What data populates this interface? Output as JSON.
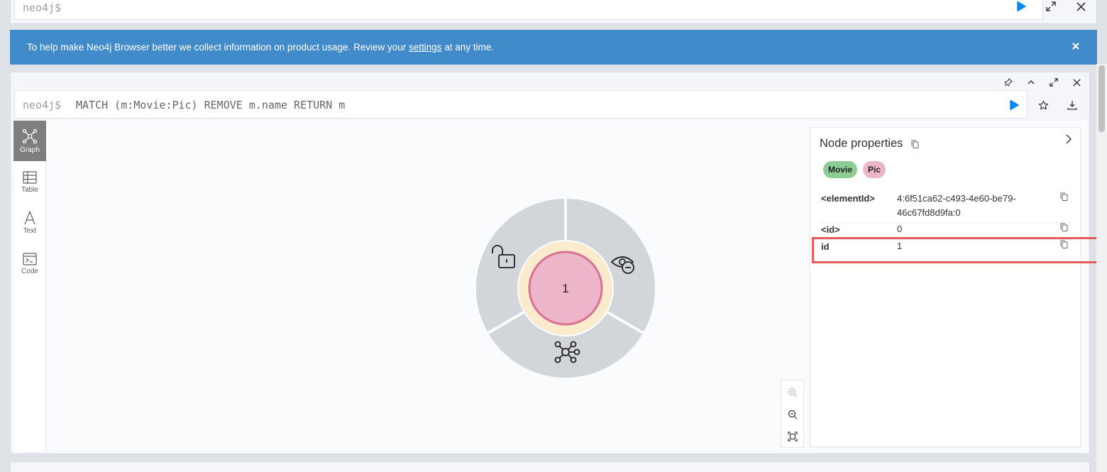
{
  "top_editor": {
    "prompt": "neo4j$"
  },
  "banner": {
    "text_before": "To help make Neo4j Browser better we collect information on product usage. Review your",
    "link": "settings",
    "text_after": "at any time."
  },
  "frame": {
    "prompt": "neo4j$",
    "query": "MATCH (m:Movie:Pic) REMOVE m.name RETURN m"
  },
  "views": [
    {
      "label": "Graph",
      "icon": "graph-icon",
      "active": true
    },
    {
      "label": "Table",
      "icon": "table-icon",
      "active": false
    },
    {
      "label": "Text",
      "icon": "text-icon",
      "active": false
    },
    {
      "label": "Code",
      "icon": "code-icon",
      "active": false
    }
  ],
  "node": {
    "caption": "1",
    "fill": "#ecb5c9",
    "stroke": "#da7194",
    "ring": "#faebcc",
    "menu_color": "#d2d5da",
    "menu_icons": [
      "unlock-icon",
      "hide-icon",
      "expand-relationships-icon"
    ]
  },
  "properties": {
    "title": "Node properties",
    "labels": [
      {
        "name": "Movie",
        "color": "#8dcc93"
      },
      {
        "name": "Pic",
        "color": "#ecb5c9"
      }
    ],
    "rows": [
      {
        "key": "<elementId>",
        "value": "4:6f51ca62-c493-4e60-be79-46c67fd8d9fa:0"
      },
      {
        "key": "<id>",
        "value": "0"
      },
      {
        "key": "id",
        "value": "1"
      }
    ],
    "highlight_color": "#e55b5b"
  },
  "colors": {
    "banner": "#428bca",
    "run": "#018bff"
  }
}
